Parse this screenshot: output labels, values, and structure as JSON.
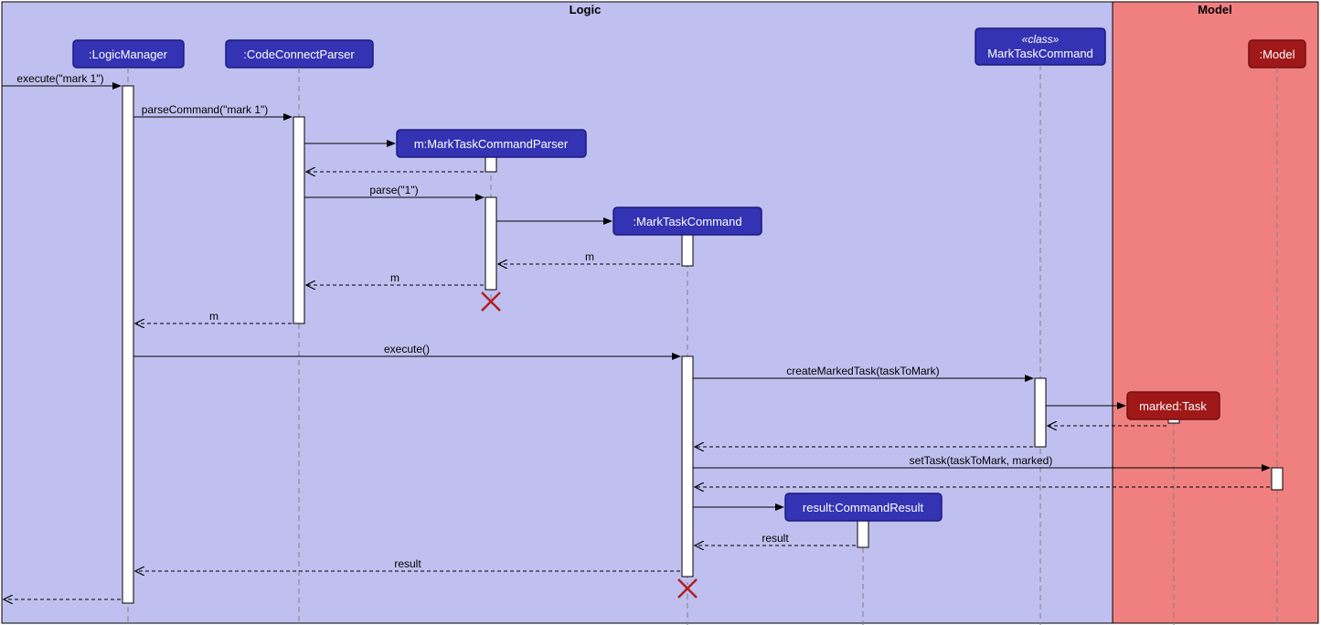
{
  "regions": {
    "logic": {
      "title": "Logic"
    },
    "model": {
      "title": "Model"
    }
  },
  "participants": {
    "logicManager": ":LogicManager",
    "codeConnectParser": ":CodeConnectParser",
    "markTaskCommandClass": {
      "stereo": "«class»",
      "name": "MarkTaskCommand"
    },
    "markTaskCommandParser": "m:MarkTaskCommandParser",
    "markTaskCommand": ":MarkTaskCommand",
    "commandResult": "result:CommandResult",
    "modelP": ":Model",
    "markedTask": "marked:Task"
  },
  "messages": {
    "execIn": "execute(\"mark 1\")",
    "parseCommand": "parseCommand(\"mark 1\")",
    "parse": "parse(\"1\")",
    "m1": "m",
    "m2": "m",
    "m3": "m",
    "execute": "execute()",
    "createMarked": "createMarkedTask(taskToMark)",
    "setTask": "setTask(taskToMark, marked)",
    "result1": "result",
    "result2": "result"
  }
}
